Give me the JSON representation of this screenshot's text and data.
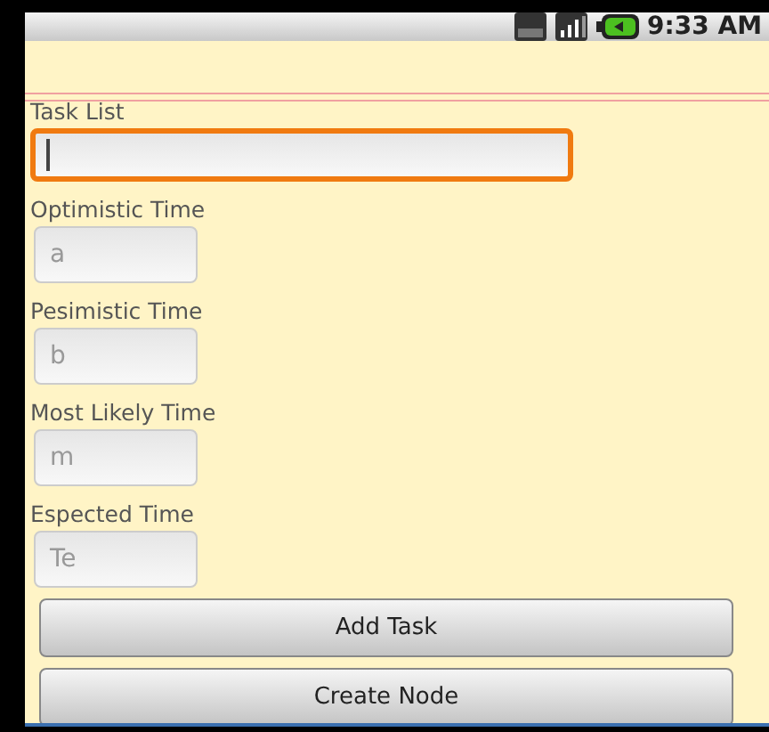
{
  "status_bar": {
    "time": "9:33 AM"
  },
  "fields": [
    {
      "label": "Task List",
      "focused": true,
      "wide": true
    },
    {
      "label": "Optimistic Time",
      "placeholder": "a",
      "focused": false,
      "wide": false
    },
    {
      "label": "Pesimistic Time",
      "placeholder": "b",
      "focused": false,
      "wide": false
    },
    {
      "label": "Most Likely Time",
      "placeholder": "m",
      "focused": false,
      "wide": false
    },
    {
      "label": "Espected Time",
      "placeholder": "Te",
      "focused": false,
      "wide": false
    }
  ],
  "buttons": [
    "Add Task",
    "Create Node"
  ]
}
